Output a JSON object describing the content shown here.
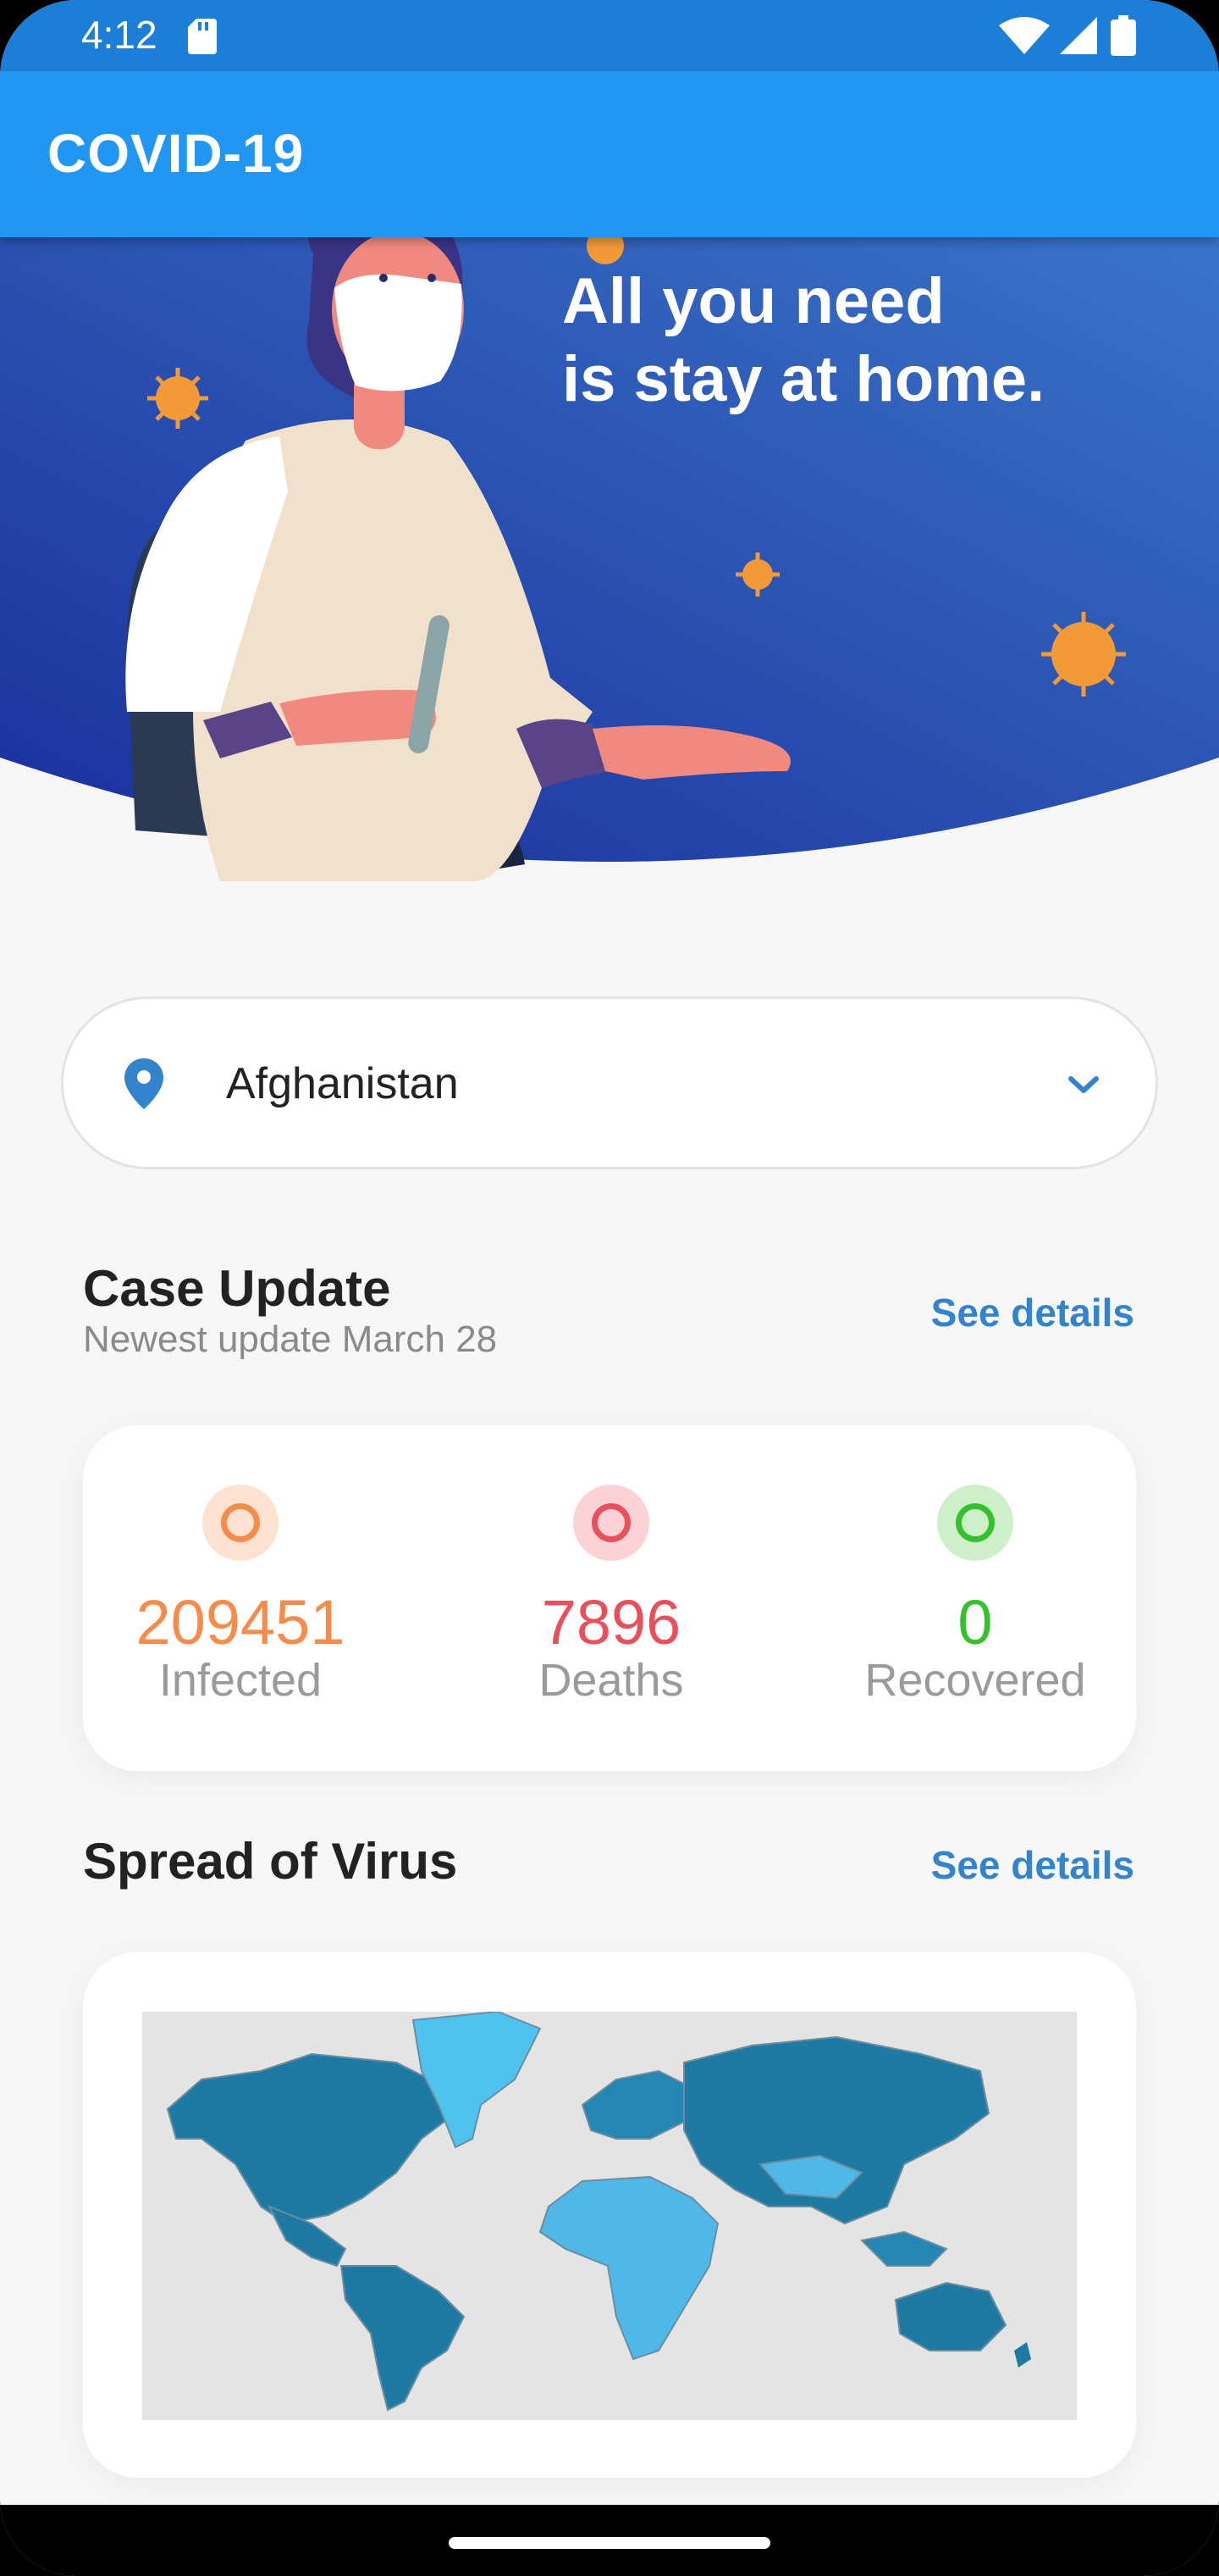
{
  "status_bar": {
    "time": "4:12"
  },
  "app_bar": {
    "title": "COVID-19"
  },
  "hero": {
    "line1": "All you need",
    "line2": "is stay at home."
  },
  "country_selector": {
    "selected": "Afghanistan"
  },
  "case_update": {
    "title": "Case Update",
    "subtitle": "Newest update March 28",
    "see_details": "See details",
    "stats": [
      {
        "value": "209451",
        "label": "Infected",
        "color": "#f58c4b",
        "ring_bg": "#fde2d0"
      },
      {
        "value": "7896",
        "label": "Deaths",
        "color": "#e8505b",
        "ring_bg": "#fbd3d6"
      },
      {
        "value": "0",
        "label": "Recovered",
        "color": "#36c12c",
        "ring_bg": "#cdf0ca"
      }
    ]
  },
  "spread": {
    "title": "Spread of Virus",
    "see_details": "See details"
  },
  "colors": {
    "status_bar": "#1c7ed6",
    "app_bar": "#2196f3",
    "hero_dark": "#1a2e9c",
    "hero_light": "#3a74c8",
    "link": "#3383cd",
    "map_land_dark": "#1e7aa3",
    "map_land_light": "#4fc3f0"
  }
}
